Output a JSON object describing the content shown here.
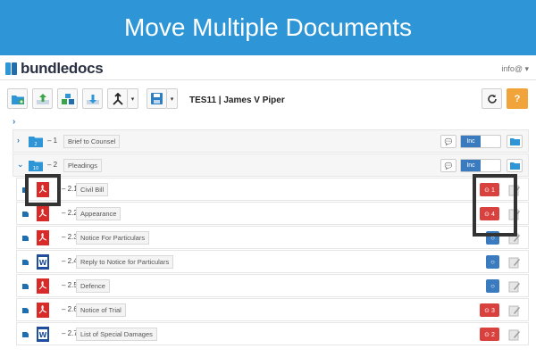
{
  "banner": {
    "title": "Move Multiple Documents"
  },
  "app": {
    "logo_text": "bundledocs",
    "user_menu": "info@ ▾"
  },
  "toolbar": {
    "case_title": "TES11 | James V Piper",
    "help_label": "?",
    "buttons": [
      "new-folder",
      "upload",
      "components",
      "download",
      "merge",
      "save"
    ]
  },
  "colors": {
    "accent": "#2e96d6",
    "red": "#d9413e",
    "blue": "#3a7bbf",
    "orange": "#f0a43a"
  },
  "tree": {
    "root_chevron": "›",
    "sections": [
      {
        "number": "1",
        "title": "Brief to Counsel",
        "folder_badge": "2",
        "expanded": false,
        "inc_label": "Inc"
      },
      {
        "number": "2",
        "title": "Pleadings",
        "folder_badge": "10",
        "expanded": true,
        "inc_label": "Inc"
      }
    ],
    "documents": [
      {
        "number": "2.1",
        "title": "Civil Bill",
        "type": "pdf",
        "status": "red",
        "status_text": "1"
      },
      {
        "number": "2.2",
        "title": "Appearance",
        "type": "pdf",
        "status": "red",
        "status_text": "4"
      },
      {
        "number": "2.3",
        "title": "Notice For Particulars",
        "type": "pdf",
        "status": "blue",
        "status_text": ""
      },
      {
        "number": "2.4",
        "title": "Reply to Notice for Particulars",
        "type": "word",
        "status": "blue",
        "status_text": ""
      },
      {
        "number": "2.5",
        "title": "Defence",
        "type": "pdf",
        "status": "blue",
        "status_text": ""
      },
      {
        "number": "2.6",
        "title": "Notice of Trial",
        "type": "pdf",
        "status": "red",
        "status_text": "3"
      },
      {
        "number": "2.7",
        "title": "List of Special Damages",
        "type": "word",
        "status": "red",
        "status_text": "2"
      }
    ]
  }
}
